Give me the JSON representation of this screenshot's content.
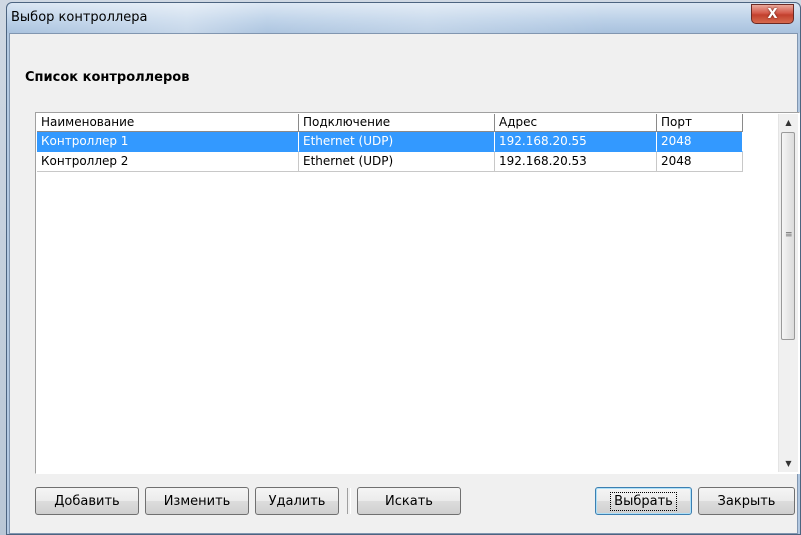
{
  "window": {
    "title": "Выбор контроллера",
    "close_glyph": "X"
  },
  "heading": "Список контроллеров",
  "table": {
    "columns": [
      "Наименование",
      "Подключение",
      "Адрес",
      "Порт"
    ],
    "rows": [
      {
        "name": "Контроллер 1",
        "connection": "Ethernet (UDP)",
        "address": "192.168.20.55",
        "port": "2048",
        "selected": true
      },
      {
        "name": "Контроллер 2",
        "connection": "Ethernet (UDP)",
        "address": "192.168.20.53",
        "port": "2048",
        "selected": false
      }
    ]
  },
  "scrollbar": {
    "up_icon": "scroll-up-arrow-icon",
    "down_icon": "scroll-down-arrow-icon",
    "up_glyph": "▲",
    "down_glyph": "▼",
    "grip_glyph": "≡"
  },
  "buttons": {
    "add": "Добавить",
    "edit": "Изменить",
    "delete": "Удалить",
    "search": "Искать",
    "select": "Выбрать",
    "close": "Закрыть"
  },
  "colors": {
    "selection": "#3399ff",
    "close_button": "#c2402e"
  }
}
